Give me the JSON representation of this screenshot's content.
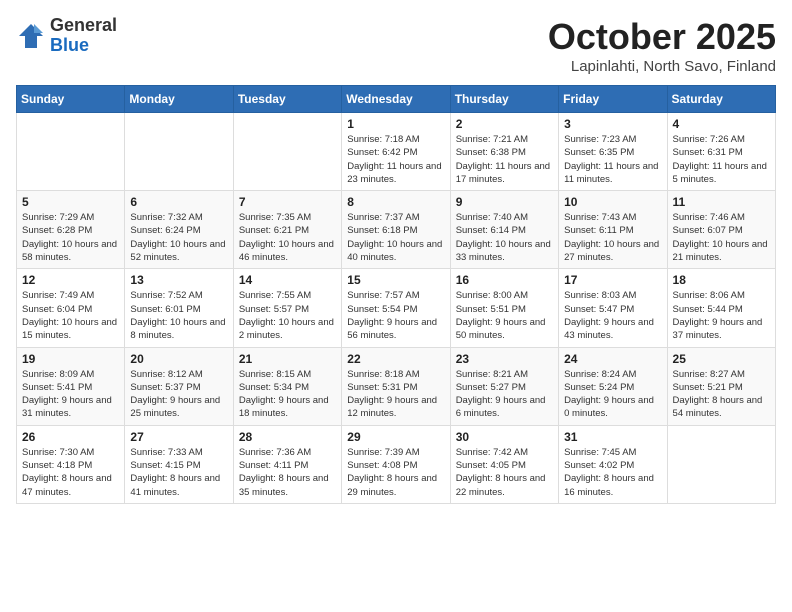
{
  "logo": {
    "text_general": "General",
    "text_blue": "Blue"
  },
  "header": {
    "month": "October 2025",
    "location": "Lapinlahti, North Savo, Finland"
  },
  "weekdays": [
    "Sunday",
    "Monday",
    "Tuesday",
    "Wednesday",
    "Thursday",
    "Friday",
    "Saturday"
  ],
  "weeks": [
    [
      {
        "day": "",
        "info": ""
      },
      {
        "day": "",
        "info": ""
      },
      {
        "day": "",
        "info": ""
      },
      {
        "day": "1",
        "info": "Sunrise: 7:18 AM\nSunset: 6:42 PM\nDaylight: 11 hours and 23 minutes."
      },
      {
        "day": "2",
        "info": "Sunrise: 7:21 AM\nSunset: 6:38 PM\nDaylight: 11 hours and 17 minutes."
      },
      {
        "day": "3",
        "info": "Sunrise: 7:23 AM\nSunset: 6:35 PM\nDaylight: 11 hours and 11 minutes."
      },
      {
        "day": "4",
        "info": "Sunrise: 7:26 AM\nSunset: 6:31 PM\nDaylight: 11 hours and 5 minutes."
      }
    ],
    [
      {
        "day": "5",
        "info": "Sunrise: 7:29 AM\nSunset: 6:28 PM\nDaylight: 10 hours and 58 minutes."
      },
      {
        "day": "6",
        "info": "Sunrise: 7:32 AM\nSunset: 6:24 PM\nDaylight: 10 hours and 52 minutes."
      },
      {
        "day": "7",
        "info": "Sunrise: 7:35 AM\nSunset: 6:21 PM\nDaylight: 10 hours and 46 minutes."
      },
      {
        "day": "8",
        "info": "Sunrise: 7:37 AM\nSunset: 6:18 PM\nDaylight: 10 hours and 40 minutes."
      },
      {
        "day": "9",
        "info": "Sunrise: 7:40 AM\nSunset: 6:14 PM\nDaylight: 10 hours and 33 minutes."
      },
      {
        "day": "10",
        "info": "Sunrise: 7:43 AM\nSunset: 6:11 PM\nDaylight: 10 hours and 27 minutes."
      },
      {
        "day": "11",
        "info": "Sunrise: 7:46 AM\nSunset: 6:07 PM\nDaylight: 10 hours and 21 minutes."
      }
    ],
    [
      {
        "day": "12",
        "info": "Sunrise: 7:49 AM\nSunset: 6:04 PM\nDaylight: 10 hours and 15 minutes."
      },
      {
        "day": "13",
        "info": "Sunrise: 7:52 AM\nSunset: 6:01 PM\nDaylight: 10 hours and 8 minutes."
      },
      {
        "day": "14",
        "info": "Sunrise: 7:55 AM\nSunset: 5:57 PM\nDaylight: 10 hours and 2 minutes."
      },
      {
        "day": "15",
        "info": "Sunrise: 7:57 AM\nSunset: 5:54 PM\nDaylight: 9 hours and 56 minutes."
      },
      {
        "day": "16",
        "info": "Sunrise: 8:00 AM\nSunset: 5:51 PM\nDaylight: 9 hours and 50 minutes."
      },
      {
        "day": "17",
        "info": "Sunrise: 8:03 AM\nSunset: 5:47 PM\nDaylight: 9 hours and 43 minutes."
      },
      {
        "day": "18",
        "info": "Sunrise: 8:06 AM\nSunset: 5:44 PM\nDaylight: 9 hours and 37 minutes."
      }
    ],
    [
      {
        "day": "19",
        "info": "Sunrise: 8:09 AM\nSunset: 5:41 PM\nDaylight: 9 hours and 31 minutes."
      },
      {
        "day": "20",
        "info": "Sunrise: 8:12 AM\nSunset: 5:37 PM\nDaylight: 9 hours and 25 minutes."
      },
      {
        "day": "21",
        "info": "Sunrise: 8:15 AM\nSunset: 5:34 PM\nDaylight: 9 hours and 18 minutes."
      },
      {
        "day": "22",
        "info": "Sunrise: 8:18 AM\nSunset: 5:31 PM\nDaylight: 9 hours and 12 minutes."
      },
      {
        "day": "23",
        "info": "Sunrise: 8:21 AM\nSunset: 5:27 PM\nDaylight: 9 hours and 6 minutes."
      },
      {
        "day": "24",
        "info": "Sunrise: 8:24 AM\nSunset: 5:24 PM\nDaylight: 9 hours and 0 minutes."
      },
      {
        "day": "25",
        "info": "Sunrise: 8:27 AM\nSunset: 5:21 PM\nDaylight: 8 hours and 54 minutes."
      }
    ],
    [
      {
        "day": "26",
        "info": "Sunrise: 7:30 AM\nSunset: 4:18 PM\nDaylight: 8 hours and 47 minutes."
      },
      {
        "day": "27",
        "info": "Sunrise: 7:33 AM\nSunset: 4:15 PM\nDaylight: 8 hours and 41 minutes."
      },
      {
        "day": "28",
        "info": "Sunrise: 7:36 AM\nSunset: 4:11 PM\nDaylight: 8 hours and 35 minutes."
      },
      {
        "day": "29",
        "info": "Sunrise: 7:39 AM\nSunset: 4:08 PM\nDaylight: 8 hours and 29 minutes."
      },
      {
        "day": "30",
        "info": "Sunrise: 7:42 AM\nSunset: 4:05 PM\nDaylight: 8 hours and 22 minutes."
      },
      {
        "day": "31",
        "info": "Sunrise: 7:45 AM\nSunset: 4:02 PM\nDaylight: 8 hours and 16 minutes."
      },
      {
        "day": "",
        "info": ""
      }
    ]
  ]
}
